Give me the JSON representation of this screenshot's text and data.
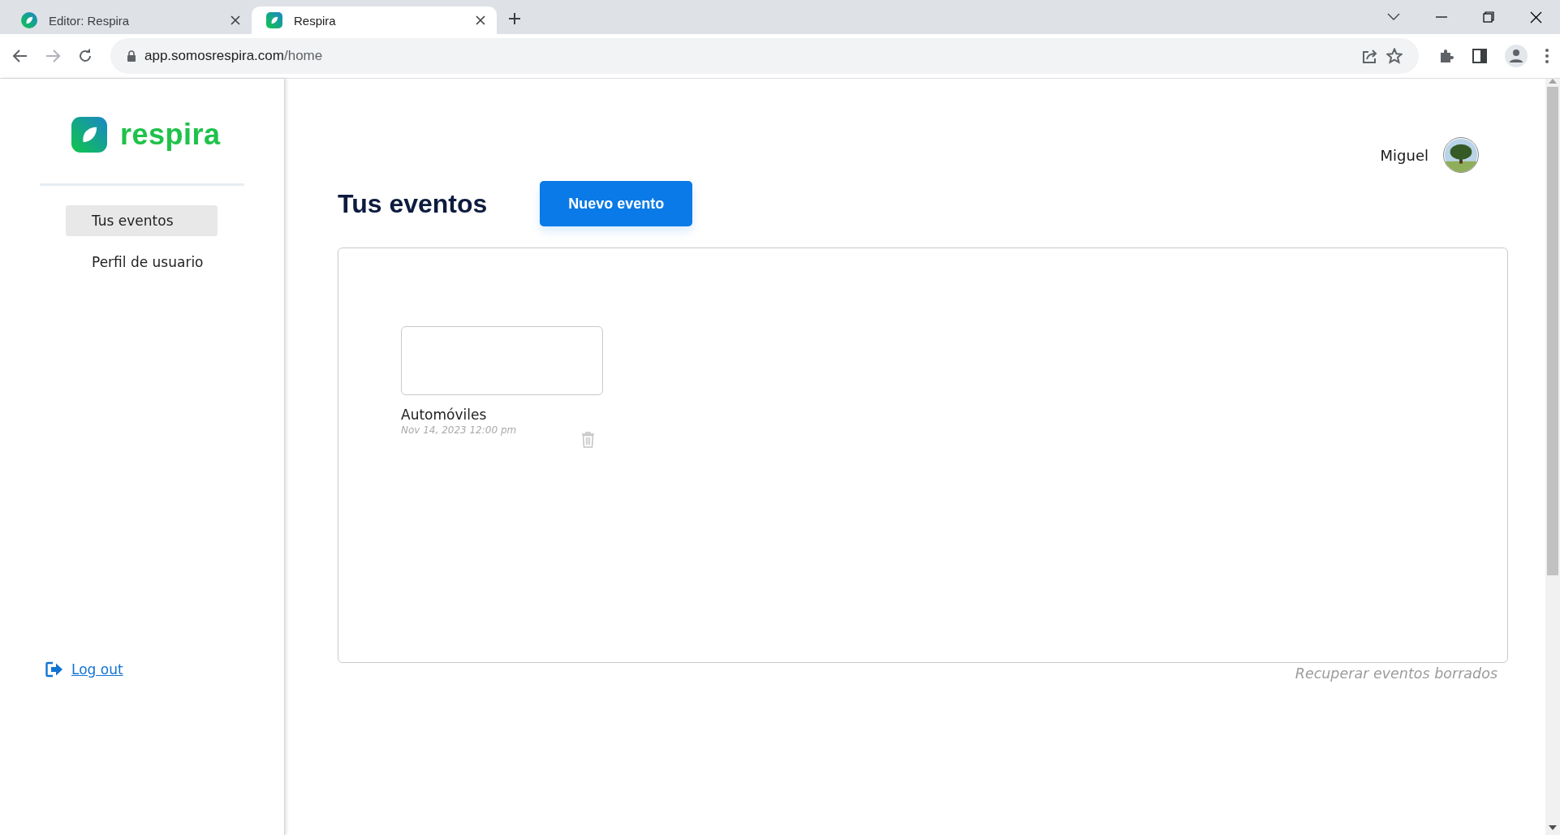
{
  "browser": {
    "tabs": [
      {
        "title": "Editor: Respira",
        "selected": false
      },
      {
        "title": "Respira",
        "selected": true
      }
    ],
    "url": {
      "host": "app.somosrespira.com",
      "path": "/home"
    }
  },
  "sidebar": {
    "logo_text": "respira",
    "nav_items": [
      {
        "label": "Tus eventos",
        "selected": true
      },
      {
        "label": "Perfil de usuario",
        "selected": false
      }
    ],
    "logout": "Log out"
  },
  "header": {
    "user_name": "Miguel"
  },
  "page": {
    "title": "Tus eventos",
    "new_button": "Nuevo evento",
    "events": [
      {
        "name": "Automóviles",
        "date": "Nov 14, 2023 12:00 pm"
      }
    ],
    "recover_link": "Recuperar eventos borrados"
  }
}
